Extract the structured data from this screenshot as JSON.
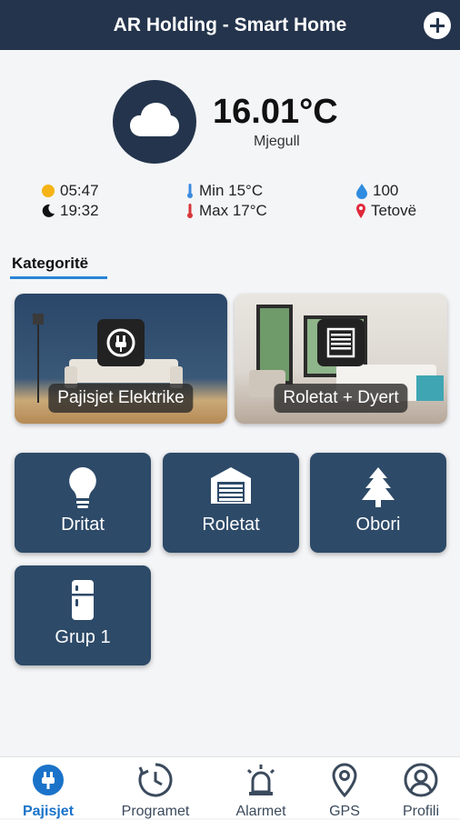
{
  "header": {
    "title": "AR Holding - Smart Home"
  },
  "weather": {
    "temperature": "16.01°C",
    "condition": "Mjegull",
    "sunrise": "05:47",
    "sunset": "19:32",
    "min": "Min 15°C",
    "max": "Max 17°C",
    "humidity": "100",
    "location": "Tetovë"
  },
  "categories": {
    "title": "Kategoritë",
    "items": [
      {
        "label": "Pajisjet Elektrike"
      },
      {
        "label": "Roletat + Dyert"
      }
    ]
  },
  "groups": [
    {
      "label": "Dritat",
      "icon": "lightbulb-icon"
    },
    {
      "label": "Roletat",
      "icon": "garage-icon"
    },
    {
      "label": "Obori",
      "icon": "tree-icon"
    },
    {
      "label": "Grup 1",
      "icon": "fridge-icon"
    }
  ],
  "nav": {
    "items": [
      {
        "label": "Pajisjet",
        "icon": "plug-icon",
        "active": true
      },
      {
        "label": "Programet",
        "icon": "clock-icon"
      },
      {
        "label": "Alarmet",
        "icon": "siren-icon"
      },
      {
        "label": "GPS",
        "icon": "location-pin-icon"
      },
      {
        "label": "Profili",
        "icon": "user-icon"
      }
    ]
  },
  "colors": {
    "primary": "#24344c",
    "tile": "#2d4a68",
    "accent": "#1a73c9"
  }
}
